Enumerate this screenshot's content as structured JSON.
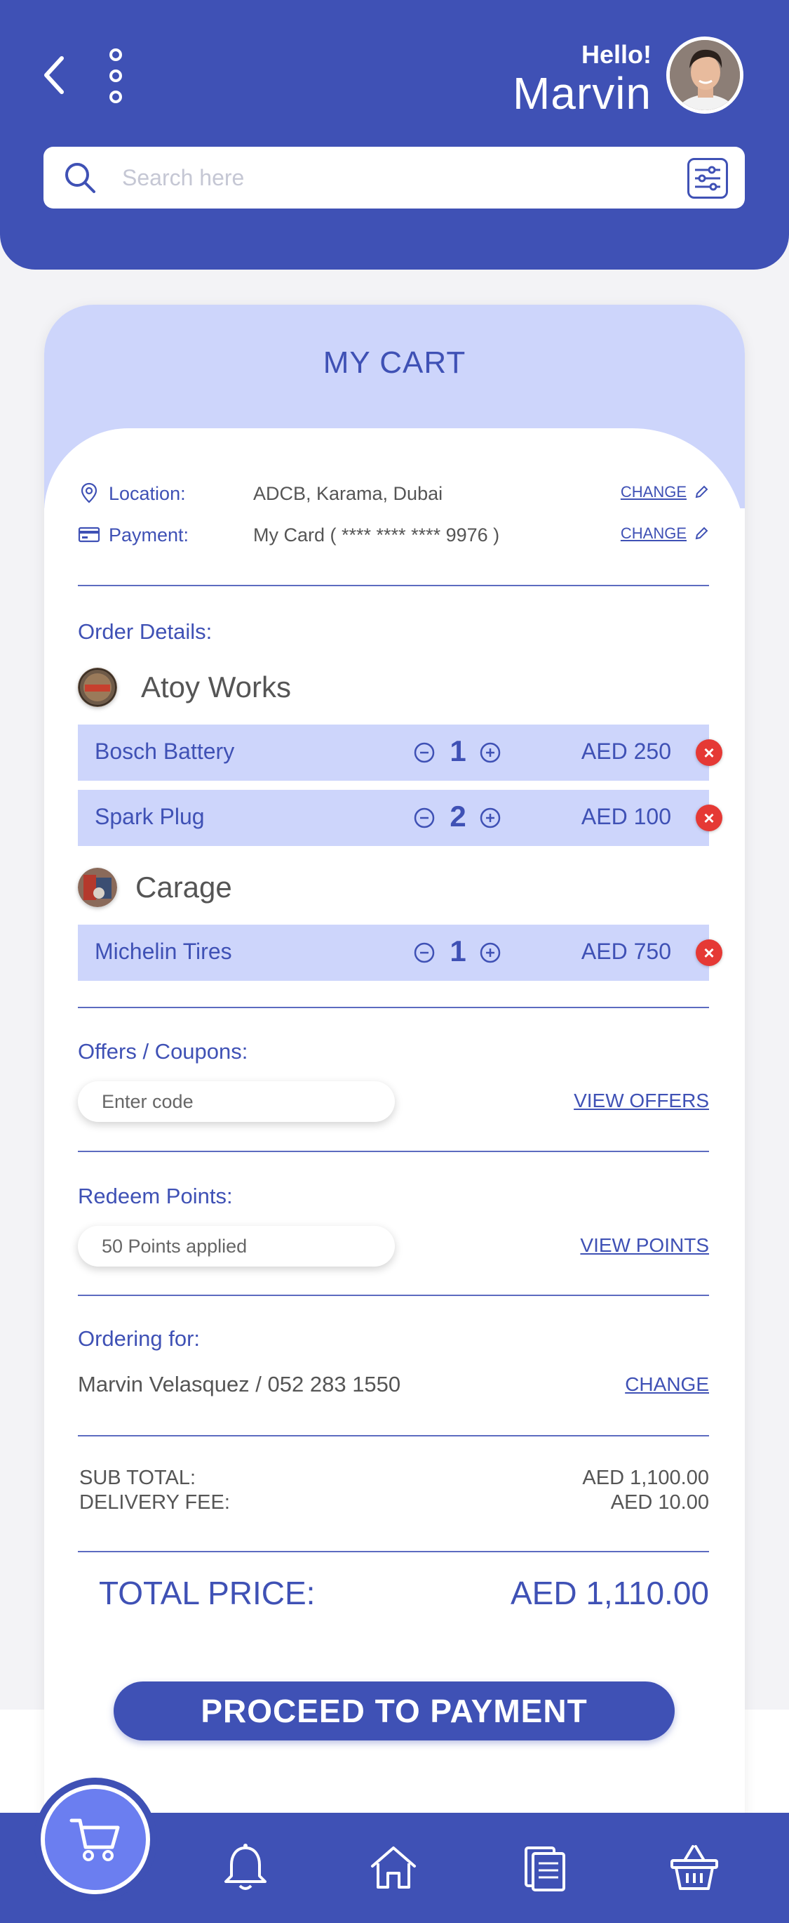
{
  "header": {
    "hello": "Hello!",
    "name": "Marvin",
    "search_placeholder": "Search here"
  },
  "cart": {
    "title": "MY CART",
    "location_label": "Location:",
    "location_value": "ADCB, Karama, Dubai",
    "payment_label": "Payment:",
    "payment_value": "My Card ( **** **** **** 9976 )",
    "change_label": "CHANGE",
    "order_details_label": "Order Details:",
    "shops": [
      {
        "name": "Atoy Works",
        "items": [
          {
            "name": "Bosch Battery",
            "qty": "1",
            "price": "AED 250"
          },
          {
            "name": "Spark Plug",
            "qty": "2",
            "price": "AED 100"
          }
        ]
      },
      {
        "name": "Carage",
        "items": [
          {
            "name": "Michelin Tires",
            "qty": "1",
            "price": "AED 750"
          }
        ]
      }
    ],
    "offers_label": "Offers / Coupons:",
    "offers_placeholder": "Enter code",
    "view_offers": "VIEW OFFERS",
    "redeem_label": "Redeem Points:",
    "redeem_value": "50 Points applied",
    "view_points": "VIEW POINTS",
    "ordering_for_label": "Ordering for:",
    "ordering_for_value": "Marvin Velasquez / 052 283 1550",
    "ordering_change": "CHANGE",
    "subtotal_label": "SUB TOTAL:",
    "subtotal_value": "AED 1,100.00",
    "delivery_label": "DELIVERY FEE:",
    "delivery_value": "AED 10.00",
    "total_label": "TOTAL PRICE:",
    "total_value": "AED 1,110.00",
    "proceed_label": "PROCEED TO PAYMENT"
  },
  "nav": {
    "icons": [
      "cart-icon",
      "bell-icon",
      "home-icon",
      "documents-icon",
      "basket-icon"
    ]
  },
  "colors": {
    "primary": "#3f51b5",
    "light": "#cdd5fb",
    "remove": "#e53935"
  }
}
